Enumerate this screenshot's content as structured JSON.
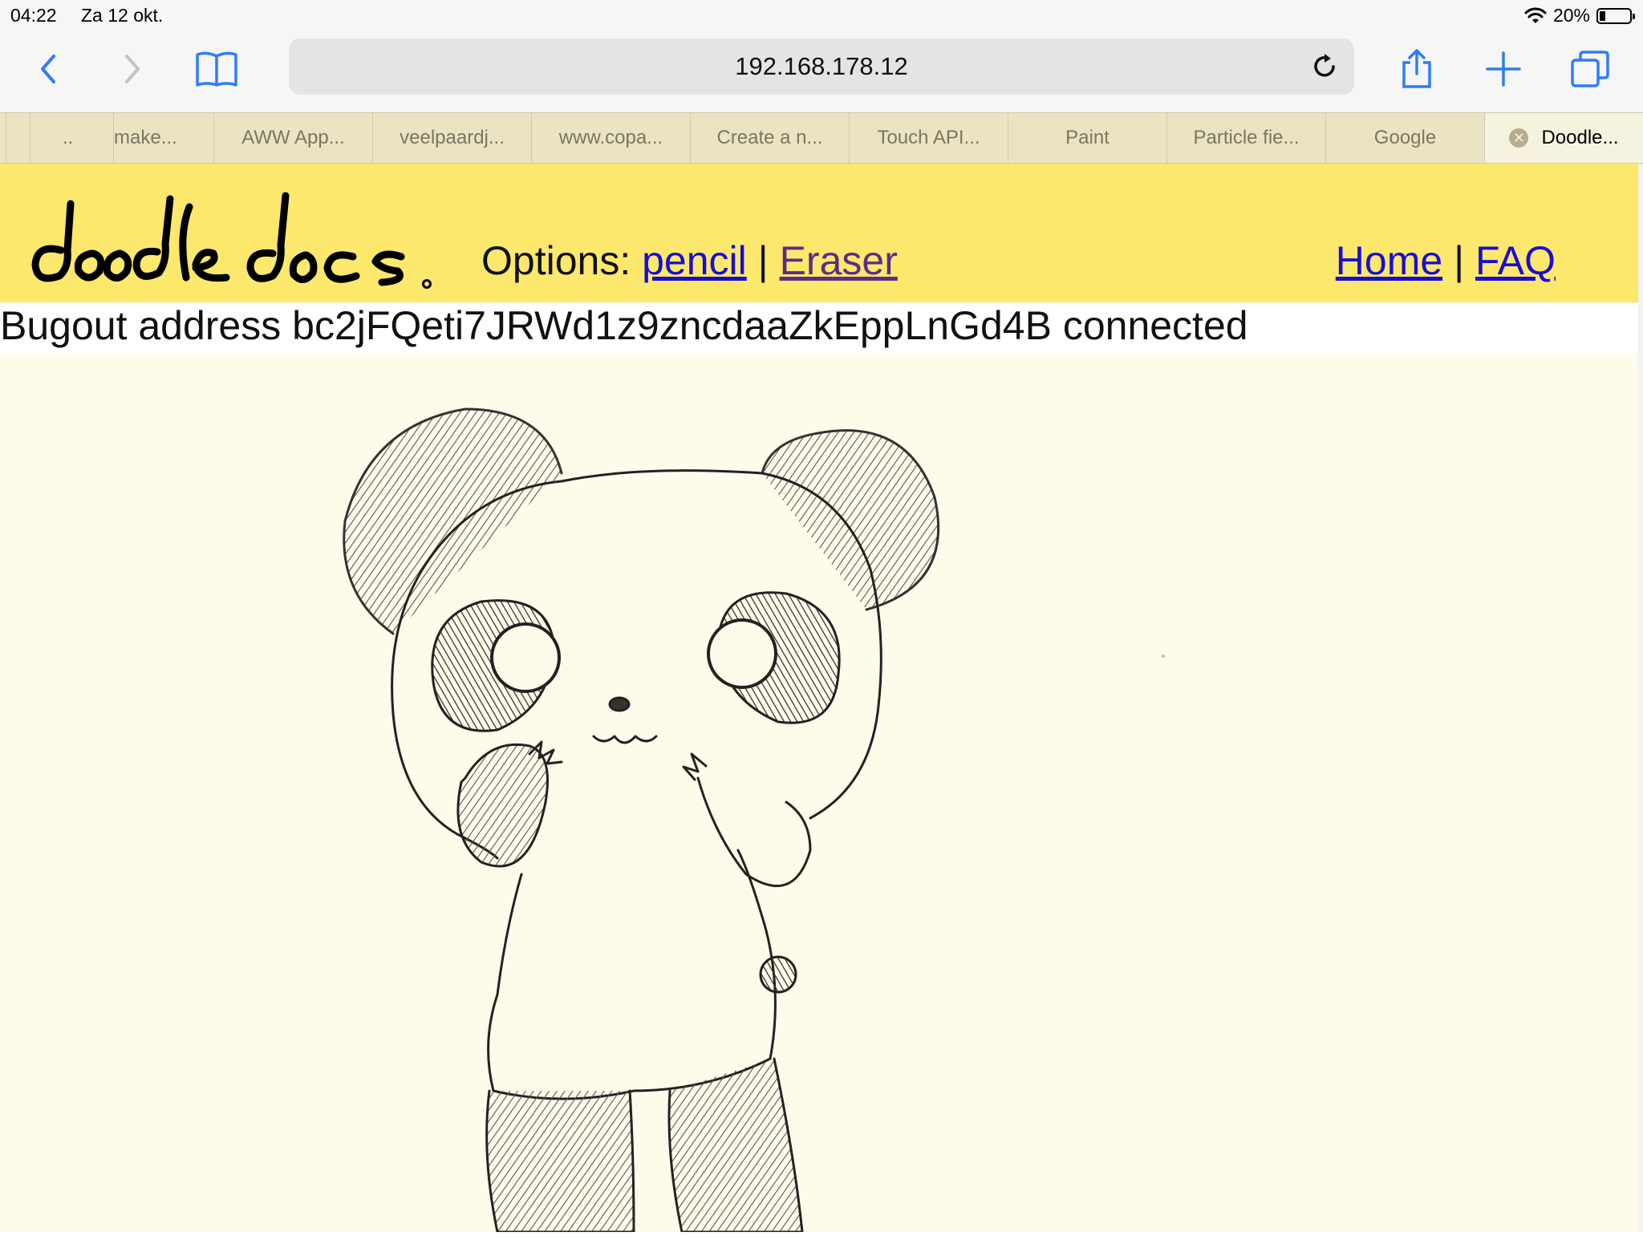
{
  "status_bar": {
    "time": "04:22",
    "date": "Za 12 okt.",
    "battery_text": "20%",
    "battery_level": 0.2
  },
  "toolbar": {
    "url": "192.168.178.12"
  },
  "tabs": [
    {
      "label": ""
    },
    {
      "label": ".."
    },
    {
      "label": "make..."
    },
    {
      "label": "AWW App..."
    },
    {
      "label": "veelpaardj..."
    },
    {
      "label": "www.copa..."
    },
    {
      "label": "Create a n..."
    },
    {
      "label": "Touch API..."
    },
    {
      "label": "Paint"
    },
    {
      "label": "Particle fie..."
    },
    {
      "label": "Google"
    },
    {
      "label": "Doodle..."
    }
  ],
  "page": {
    "logo_text": "doodle docs",
    "options_label": "Options:",
    "option_pencil": "pencil",
    "separator": "|",
    "option_eraser": "Eraser",
    "nav_home": "Home",
    "nav_faq": "FAQ",
    "status_message": "Bugout address bc2jFQeti7JRWd1z9zncdaaZkEppLnGd4B connected"
  },
  "colors": {
    "header_bg": "#fce86c",
    "canvas_bg": "#fffbea",
    "tabbar_bg": "#ebe4c3",
    "link_blue": "#1a0dd4",
    "link_visited": "#5d2d86",
    "ios_blue": "#2f7cf6"
  }
}
